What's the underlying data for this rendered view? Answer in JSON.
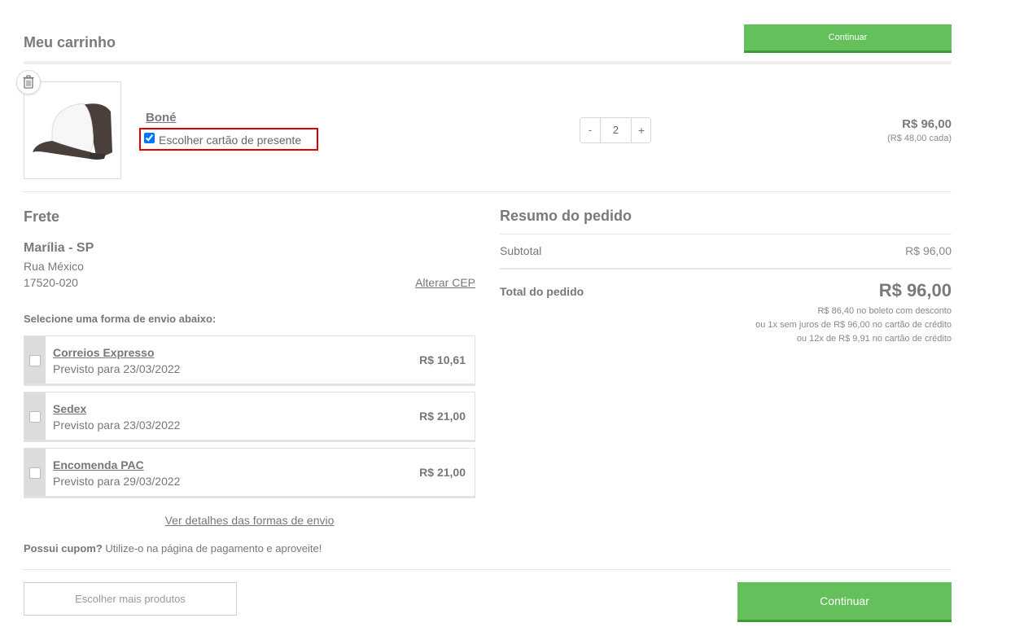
{
  "cart": {
    "title": "Meu carrinho",
    "continue_top": "Continuar"
  },
  "item": {
    "name": "Boné",
    "gift_label": "Escolher cartão de presente",
    "gift_checked": true,
    "qty_minus": "-",
    "qty_value": "2",
    "qty_plus": "+",
    "price_total": "R$ 96,00",
    "price_unit": "(R$ 48,00 cada)",
    "image_icon": "cap-icon",
    "delete_icon": "trash-icon"
  },
  "shipping": {
    "title": "Frete",
    "city": "Marília - SP",
    "street": "Rua México",
    "cep": "17520-020",
    "change_cep": "Alterar CEP",
    "select_label": "Selecione uma forma de envio abaixo:",
    "options": [
      {
        "name": "Correios Expresso",
        "date": "Previsto para 23/03/2022",
        "price": "R$ 10,61"
      },
      {
        "name": "Sedex",
        "date": "Previsto para 23/03/2022",
        "price": "R$ 21,00"
      },
      {
        "name": "Encomenda PAC",
        "date": "Previsto para 29/03/2022",
        "price": "R$ 21,00"
      }
    ],
    "details_link": "Ver detalhes das formas de envio",
    "coupon_bold": "Possui cupom?",
    "coupon_text": " Utilize-o na página de pagamento e aproveite!"
  },
  "summary": {
    "title": "Resumo do pedido",
    "subtotal_label": "Subtotal",
    "subtotal_value": "R$ 96,00",
    "total_label": "Total do pedido",
    "total_value": "R$ 96,00",
    "boleto": "R$ 86,40 no boleto com desconto",
    "credit_1x": "ou 1x sem juros de R$ 96,00 no cartão de crédito",
    "credit_12x": "ou 12x de R$ 9,91 no cartão de crédito"
  },
  "footer": {
    "more_products": "Escolher mais produtos",
    "continue_bottom": "Continuar"
  },
  "colors": {
    "accent_green": "#63c05a",
    "highlight_red": "#e00000"
  }
}
